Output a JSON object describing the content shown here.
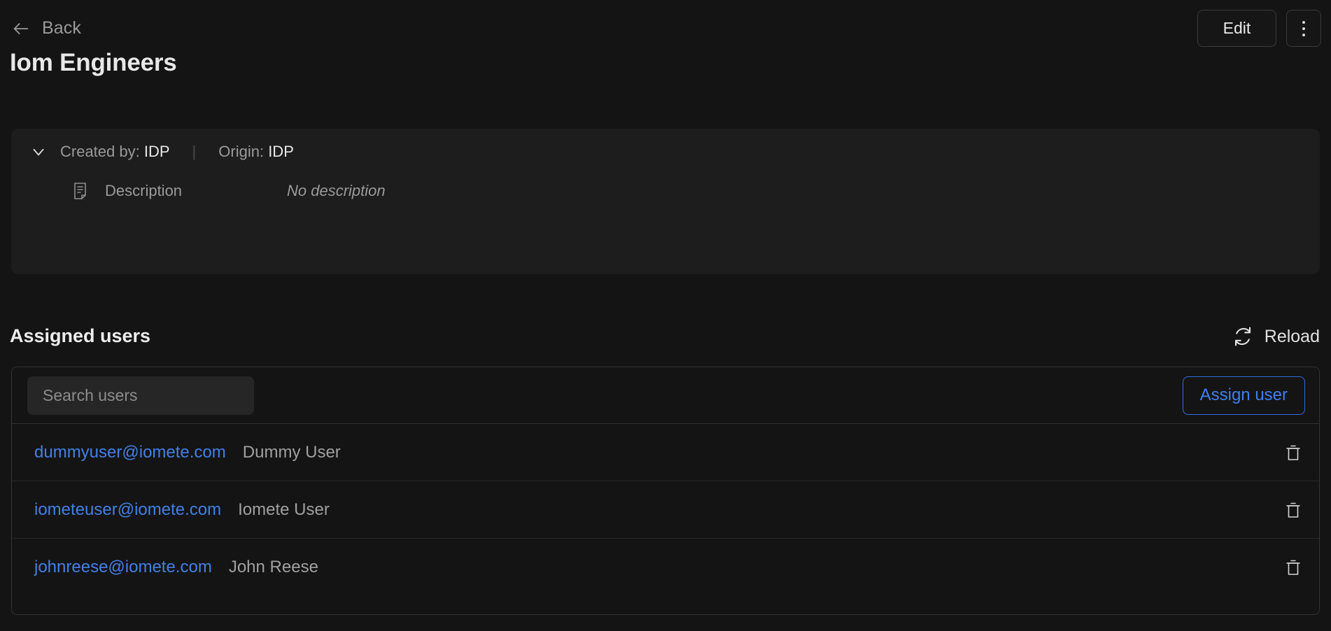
{
  "topbar": {
    "back_label": "Back",
    "back_icon": "arrow-left-icon",
    "edit_label": "Edit",
    "kebab_icon": "more-vertical-icon"
  },
  "page_title": "Iom Engineers",
  "info_card": {
    "chevron_icon": "chevron-down-icon",
    "created_by_label": "Created by:",
    "created_by_value": "IDP",
    "separator": "|",
    "origin_label": "Origin:",
    "origin_value": "IDP",
    "description_icon": "document-text-icon",
    "description_label": "Description",
    "description_value": "No description"
  },
  "assigned_users": {
    "section_title": "Assigned users",
    "reload_label": "Reload",
    "reload_icon": "refresh-icon",
    "search_placeholder": "Search users",
    "search_value": "",
    "assign_label": "Assign user",
    "delete_icon": "trash-icon",
    "rows": [
      {
        "email": "dummyuser@iomete.com",
        "name": "Dummy User"
      },
      {
        "email": "iometeuser@iomete.com",
        "name": "Iomete User"
      },
      {
        "email": "johnreese@iomete.com",
        "name": "John Reese"
      }
    ]
  },
  "colors": {
    "page_bg": "#141414",
    "card_bg": "#1d1d1d",
    "accent_blue": "#4280e6",
    "border": "#333333",
    "text_primary": "#e8e8e8",
    "text_muted": "#9a9a9a"
  }
}
